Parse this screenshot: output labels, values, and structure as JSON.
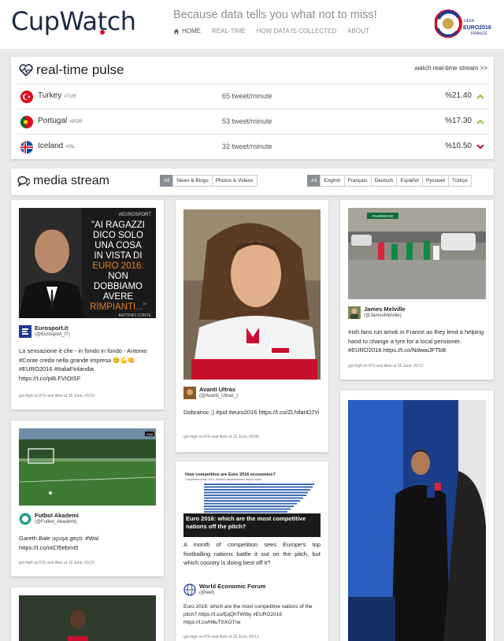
{
  "brand": {
    "logo": "CupWatch",
    "tagline": "Because data tells you what not to miss!",
    "euro_logo_text": "EURO2016",
    "euro_logo_sub": "FRANCE"
  },
  "nav": {
    "home": "HOME",
    "realtime": "REAL-TIME",
    "how": "HOW DATA IS COLLECTED",
    "about": "ABOUT"
  },
  "pulse": {
    "title": "real-time pulse",
    "link": "watch real-time stream >>",
    "rows": [
      {
        "country": "Turkey",
        "tag": "#TUR",
        "rate": "65 tweet/minute",
        "pct": "%21.40",
        "trend": "up"
      },
      {
        "country": "Portugal",
        "tag": "#POR",
        "rate": "53 tweet/minute",
        "pct": "%17.30",
        "trend": "up"
      },
      {
        "country": "Iceland",
        "tag": "#ISL",
        "rate": "32 tweet/minute",
        "pct": "%10.50",
        "trend": "down"
      }
    ]
  },
  "stream": {
    "title": "media stream",
    "type_filters": [
      "All",
      "News & Blogs",
      "Photos & Videos"
    ],
    "lang_filters": [
      "All",
      "English",
      "Français",
      "Deutsch",
      "Español",
      "Русский",
      "Türkçe"
    ]
  },
  "cards": {
    "c1": {
      "img_lines": [
        "\"AI RAGAZZI",
        "DICO SOLO",
        "UNA COSA",
        "IN VISTA DI",
        "EURO 2016:",
        "NON",
        "DOBBIAMO",
        "AVERE",
        "RIMPIANTI...\""
      ],
      "img_brand": "#EUROSPORT",
      "img_credit": "ANTONIO CONTE",
      "name": "Eurosport.it",
      "handle": "(@Eurosport_IT)",
      "text": "La sensazione è che - in fondo in fondo - Antonio #Conte creda nella grande impresa 😊💪👊 #EURO2016 #ItaliaFinlandia https://t.co/p8LFVIOISF",
      "meta": "got high on RTs and likes at 15 June, 09:19"
    },
    "c2": {
      "name": "Futbol Akademi",
      "handle": "(@Futbol_Akademi)",
      "img_brand": "FAM",
      "text": "Gareth Bale uçuşa geçti. #Wal https://t.co/otCf5ebmI5",
      "meta": "got high on RTs and likes at 15 June, 09:13"
    },
    "c3": {
      "name": "Avanti Ultras",
      "handle": "(@Avanti_Ultras_)",
      "text": "Dobranoc ;) #pol #euro2016 https://t.co/ZLNfanDJYi",
      "meta": "got high on RTs and likes at 15 June, 09:06"
    },
    "c4": {
      "img_header": "How competitive are Euro 2016 economies?",
      "img_sub": "Competitive Index 2016, Global Competitiveness Report score",
      "img_caption": "Euro 2016: which are the most competitive nations off the pitch?",
      "intro": "A month of competition sees Europe's top footballing nations battle it out on the pitch, but which country is doing best off it?",
      "name": "World Economic Forum",
      "handle": "(@wef)",
      "text": "Euro 2016: which are the most competitive nations of the pitch? https://t.co/EqQhTWIby #EURO2016 https://t.co/H6uTSXOTne",
      "meta": "got high on RTs and likes at 15 June, 09:12"
    },
    "c5": {
      "name": "James Melville",
      "handle": "(@JamesMelville)",
      "img_sign": "PHARMACIE",
      "text": "Irish fans run amok in France as they lend a helping hand to change a tyre for a local pensioner. #EURO2016 https://t.co/NdwaiJFTbB",
      "meta": "got high on RTs and likes at 15 June, 09:12"
    }
  },
  "colors": {
    "up": "#8dc63f",
    "down": "#c8102e",
    "accent": "#1f2a44"
  }
}
